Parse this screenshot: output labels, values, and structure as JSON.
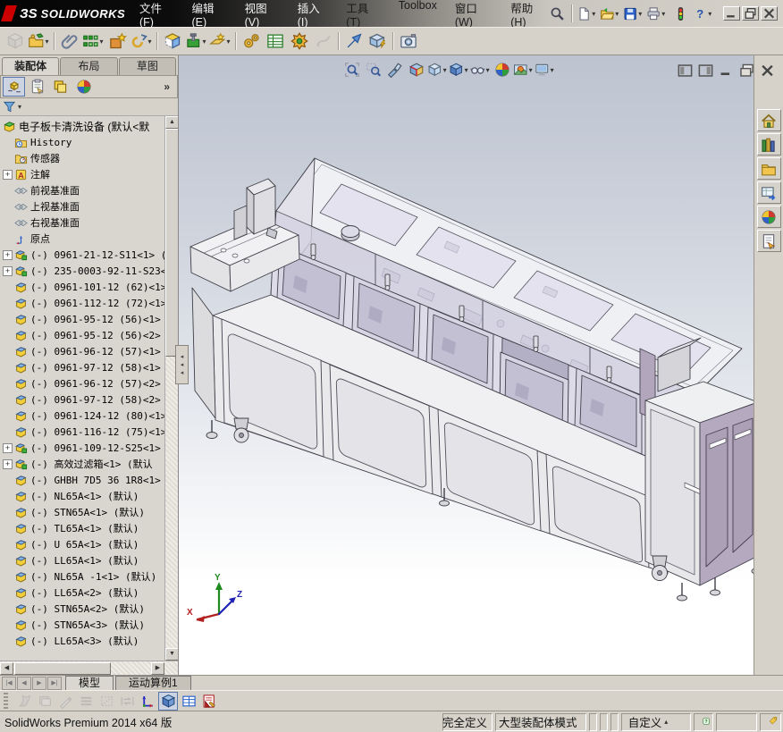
{
  "titlebar": {
    "logo_mark": "ЗS",
    "logo_text": "SOLIDWORKS",
    "menus": [
      "文件(F)",
      "编辑(E)",
      "视图(V)",
      "插入(I)",
      "工具(T)",
      "Toolbox",
      "窗口(W)",
      "帮助(H)"
    ],
    "quick_buttons": [
      {
        "name": "search-button",
        "icon": "search"
      },
      {
        "name": "toolbar-separator",
        "sep": true
      },
      {
        "name": "new-document-button",
        "icon": "doc-new",
        "dd": true
      },
      {
        "name": "open-button",
        "icon": "folder-open",
        "dd": true
      },
      {
        "name": "save-button",
        "icon": "floppy",
        "dd": true
      },
      {
        "name": "print-button",
        "icon": "printer",
        "dd": true
      },
      {
        "name": "rebuild-button",
        "icon": "traffic"
      },
      {
        "name": "help-button",
        "icon": "help",
        "dd": true
      }
    ],
    "window_buttons": [
      {
        "name": "minimize-button",
        "icon": "win-min"
      },
      {
        "name": "restore-button",
        "icon": "win-restore"
      },
      {
        "name": "close-button",
        "icon": "win-close"
      }
    ]
  },
  "main_toolbar": {
    "buttons": [
      {
        "name": "insert-components-button",
        "icon": "cube-gray",
        "dis": true
      },
      {
        "name": "edit-component-button",
        "icon": "folder-edit",
        "dd": true
      },
      {
        "name": "toolbar-separator",
        "sep": true
      },
      {
        "name": "mate-button",
        "icon": "clip"
      },
      {
        "name": "linear-component-pattern-button",
        "icon": "pattern",
        "dd": true
      },
      {
        "name": "smart-fasteners-button",
        "icon": "box-star"
      },
      {
        "name": "move-component-button",
        "icon": "crank",
        "dd": true
      },
      {
        "name": "toolbar-separator",
        "sep": true
      },
      {
        "name": "show-hidden-components-button",
        "icon": "cube-hidden"
      },
      {
        "name": "assembly-features-button",
        "icon": "block-green",
        "dd": true
      },
      {
        "name": "reference-geometry-button",
        "icon": "plane-star",
        "dd": true
      },
      {
        "name": "toolbar-separator",
        "sep": true
      },
      {
        "name": "new-motion-study-button",
        "icon": "gears"
      },
      {
        "name": "bill-of-materials-button",
        "icon": "bom"
      },
      {
        "name": "exploded-view-button",
        "icon": "burst"
      },
      {
        "name": "explode-line-sketch-button",
        "icon": "sketch-gray",
        "dis": true
      },
      {
        "name": "toolbar-separator",
        "sep": true
      },
      {
        "name": "instant3d-button",
        "icon": "arrow-blue"
      },
      {
        "name": "large-assembly-mode-button",
        "icon": "cube-bolt"
      },
      {
        "name": "toolbar-separator",
        "sep": true
      },
      {
        "name": "screen-capture-button",
        "icon": "camera"
      }
    ]
  },
  "panel": {
    "tabs": [
      {
        "label": "装配体",
        "active": true,
        "name": "tab-assembly"
      },
      {
        "label": "布局",
        "name": "tab-layout"
      },
      {
        "label": "草图",
        "name": "tab-sketch"
      }
    ],
    "fm_tabs": [
      {
        "name": "featuremanager-tree-tab",
        "icon": "fm-tree",
        "active": true
      },
      {
        "name": "propertymanager-tab",
        "icon": "fm-props"
      },
      {
        "name": "configurationmanager-tab",
        "icon": "fm-config"
      },
      {
        "name": "displaymanager-tab",
        "icon": "ball"
      }
    ],
    "overflow_label": "»",
    "filter": {
      "icon": "funnel"
    },
    "tree": [
      {
        "icon": "asmroot",
        "label": "电子板卡清洗设备 (默认<默",
        "root": true
      },
      {
        "icon": "hist",
        "label": "History"
      },
      {
        "icon": "sensor",
        "label": "传感器"
      },
      {
        "icon": "ann",
        "label": "注解",
        "expand": true
      },
      {
        "icon": "plane",
        "label": "前视基准面"
      },
      {
        "icon": "plane",
        "label": "上视基准面"
      },
      {
        "icon": "plane",
        "label": "右视基准面"
      },
      {
        "icon": "origin",
        "label": "原点"
      },
      {
        "icon": "asm",
        "label": "(-) 0961-21-12-S11<1> (",
        "expand": true
      },
      {
        "icon": "asm",
        "label": "(-) 235-0003-92-11-S23<",
        "expand": true
      },
      {
        "icon": "part",
        "label": "(-) 0961-101-12 (62)<1>"
      },
      {
        "icon": "part",
        "label": "(-) 0961-112-12 (72)<1>"
      },
      {
        "icon": "part",
        "label": "(-) 0961-95-12 (56)<1>"
      },
      {
        "icon": "part",
        "label": "(-) 0961-95-12 (56)<2>"
      },
      {
        "icon": "part",
        "label": "(-) 0961-96-12 (57)<1>"
      },
      {
        "icon": "part",
        "label": "(-) 0961-97-12 (58)<1>"
      },
      {
        "icon": "part",
        "label": "(-) 0961-96-12 (57)<2>"
      },
      {
        "icon": "part",
        "label": "(-) 0961-97-12 (58)<2>"
      },
      {
        "icon": "part",
        "label": "(-) 0961-124-12 (80)<1>"
      },
      {
        "icon": "part",
        "label": "(-) 0961-116-12 (75)<1>"
      },
      {
        "icon": "asm",
        "label": "(-) 0961-109-12-S25<1>",
        "expand": true
      },
      {
        "icon": "asm",
        "label": "(-) 高效过滤箱<1> (默认",
        "expand": true
      },
      {
        "icon": "part",
        "label": "(-) GHBH 7D5 36 1R8<1>"
      },
      {
        "icon": "part",
        "label": "(-) NL65A<1> (默认)"
      },
      {
        "icon": "part",
        "label": "(-) STN65A<1> (默认)"
      },
      {
        "icon": "part",
        "label": "(-) TL65A<1> (默认)"
      },
      {
        "icon": "part",
        "label": "(-) U 65A<1> (默认)"
      },
      {
        "icon": "part",
        "label": "(-) LL65A<1> (默认)"
      },
      {
        "icon": "part",
        "label": "(-) NL65A -1<1> (默认)"
      },
      {
        "icon": "part",
        "label": "(-) LL65A<2> (默认)"
      },
      {
        "icon": "part",
        "label": "(-) STN65A<2> (默认)"
      },
      {
        "icon": "part",
        "label": "(-) STN65A<3> (默认)"
      },
      {
        "icon": "part",
        "label": "(-) LL65A<3> (默认)"
      }
    ]
  },
  "viewport": {
    "headsup": [
      {
        "name": "zoom-to-fit-button",
        "icon": "zoom-fit"
      },
      {
        "name": "zoom-to-area-button",
        "icon": "zoom-area"
      },
      {
        "name": "previous-view-button",
        "icon": "wand"
      },
      {
        "name": "section-view-button",
        "icon": "section"
      },
      {
        "name": "view-orientation-button",
        "icon": "cube",
        "dd": true
      },
      {
        "name": "display-style-button",
        "icon": "cube-shaded",
        "dd": true
      },
      {
        "name": "hide-show-items-button",
        "icon": "glasses",
        "dd": true
      },
      {
        "name": "edit-appearance-button",
        "icon": "ball"
      },
      {
        "name": "apply-scene-button",
        "icon": "scene",
        "dd": true
      },
      {
        "name": "view-settings-button",
        "icon": "monitor",
        "dd": true
      }
    ],
    "window_buttons": [
      {
        "name": "collapse-left-pane-button",
        "icon": "pane-left"
      },
      {
        "name": "collapse-right-pane-button",
        "icon": "pane-right"
      },
      {
        "name": "doc-minimize-button",
        "icon": "win-min"
      },
      {
        "name": "doc-cascade-button",
        "icon": "cascade"
      },
      {
        "name": "doc-close-button",
        "icon": "win-close"
      }
    ],
    "triad": {
      "x": "X",
      "y": "Y",
      "z": "Z"
    }
  },
  "taskpane": [
    {
      "name": "resources-tab",
      "icon": "home"
    },
    {
      "name": "design-library-tab",
      "icon": "books"
    },
    {
      "name": "file-explorer-tab",
      "icon": "folder"
    },
    {
      "name": "view-palette-tab",
      "icon": "palette"
    },
    {
      "name": "appearances-tab",
      "icon": "ball"
    },
    {
      "name": "custom-properties-tab",
      "icon": "sheet"
    }
  ],
  "bottom_tabs": {
    "nav": [
      "|◀",
      "◀",
      "▶",
      "▶|"
    ],
    "tabs": [
      {
        "label": "模型",
        "active": true,
        "name": "tab-model"
      },
      {
        "label": "运动算例1",
        "name": "tab-motion-study-1"
      }
    ]
  },
  "bottom_toolbar": [
    {
      "name": "sheet-set-button",
      "icon": "pages",
      "dis": true
    },
    {
      "name": "layers-button",
      "icon": "layers",
      "dis": true
    },
    {
      "name": "draft-quality-button",
      "icon": "pencil",
      "dis": true
    },
    {
      "name": "line-format-button",
      "icon": "flatlines",
      "dis": true
    },
    {
      "name": "hatch-button",
      "icon": "hatch",
      "dis": true
    },
    {
      "name": "swap-views-button",
      "icon": "swap",
      "dis": true
    },
    {
      "name": "coordinate-system-button",
      "icon": "axes"
    },
    {
      "name": "shaded-view-button",
      "icon": "cube-shaded",
      "active": true
    },
    {
      "name": "grid-button",
      "icon": "grid-table"
    },
    {
      "name": "record-view-button",
      "icon": "record"
    }
  ],
  "statusbar": {
    "product": "SolidWorks Premium 2014 x64 版",
    "cells": [
      {
        "text": "完全定义",
        "name": "status-fully-defined"
      },
      {
        "text": "大型装配体模式",
        "name": "status-large-assembly-mode"
      },
      {
        "name": "status-cell-empty"
      },
      {
        "name": "status-cell-empty"
      },
      {
        "name": "status-cell-empty"
      },
      {
        "text": "自定义",
        "caret": "▴",
        "name": "status-custom"
      },
      {
        "icon": "help-badge",
        "name": "status-help-badge"
      },
      {
        "name": "status-cell-empty"
      },
      {
        "icon": "tag",
        "name": "status-tag"
      }
    ]
  }
}
